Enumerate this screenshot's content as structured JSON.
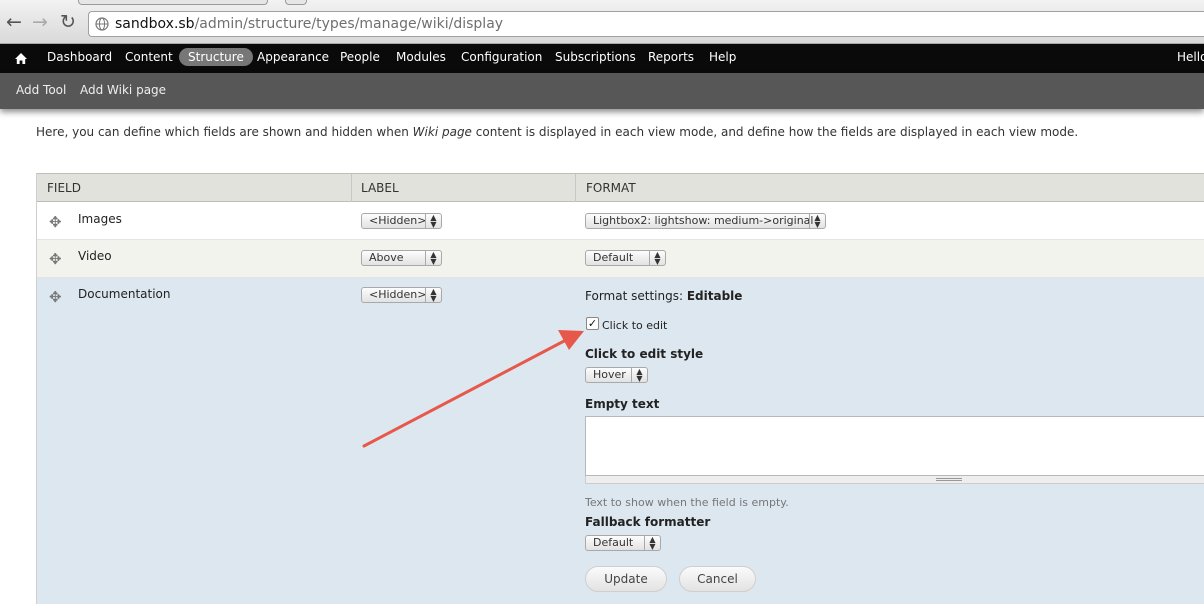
{
  "browser": {
    "url_host": "sandbox.sb",
    "url_path": "/admin/structure/types/manage/wiki/display",
    "back_glyph": "←",
    "forward_glyph": "→",
    "reload_glyph": "↻"
  },
  "toolbar": {
    "home_icon": "⌂",
    "items": [
      "Dashboard",
      "Content",
      "Structure",
      "Appearance",
      "People",
      "Modules",
      "Configuration",
      "Subscriptions",
      "Reports",
      "Help"
    ],
    "active": "Structure",
    "greeting": "Hello"
  },
  "shortcuts": [
    "Add Tool",
    "Add Wiki page"
  ],
  "intro": {
    "before": "Here, you can define which fields are shown and hidden when ",
    "emphasis": "Wiki page",
    "after": " content is displayed in each view mode, and define how the fields are displayed in each view mode."
  },
  "table": {
    "headers": [
      "Field",
      "Label",
      "Format"
    ],
    "rows": [
      {
        "field": "Images",
        "label": "<Hidden>",
        "format": "Lightbox2: lightshow: medium->original"
      },
      {
        "field": "Video",
        "label": "Above",
        "format": "Default"
      },
      {
        "field": "Documentation",
        "label": "<Hidden>"
      }
    ]
  },
  "format_settings": {
    "title_prefix": "Format settings:",
    "title_value": "Editable",
    "click_to_edit_checked": true,
    "click_to_edit_label": "Click to edit",
    "style_label": "Click to edit style",
    "style_value": "Hover",
    "empty_text_label": "Empty text",
    "empty_text_value": "",
    "empty_text_help": "Text to show when the field is empty.",
    "fallback_label": "Fallback formatter",
    "fallback_value": "Default",
    "update_button": "Update",
    "cancel_button": "Cancel"
  },
  "colors": {
    "annotation_arrow": "#e8584a",
    "row_highlight": "#dde7ef",
    "row_alt": "#f3f3ee"
  }
}
